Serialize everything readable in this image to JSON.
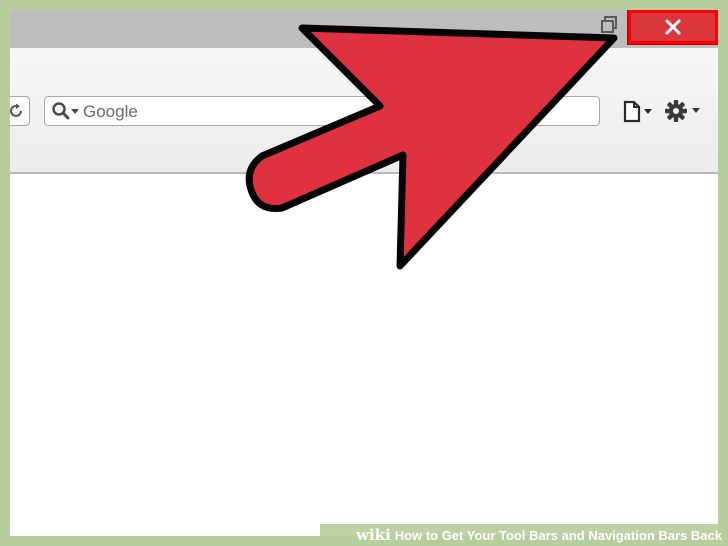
{
  "window": {
    "restore_icon": "restore-window-icon",
    "close_icon": "close-x-icon",
    "close_accent": "#d9363e",
    "highlight_color": "#ff0000"
  },
  "toolbar": {
    "reload_icon": "reload-icon",
    "search": {
      "engine_icon": "search-icon",
      "placeholder": "Google"
    },
    "page_icon": "page-menu-icon",
    "tools_icon": "gear-icon"
  },
  "annotation": {
    "arrow_color": "#e0313f",
    "arrow_icon": "pointer-arrow"
  },
  "watermark": {
    "brand": "wiki",
    "title": "How to Get Your Tool Bars and Navigation Bars Back"
  }
}
